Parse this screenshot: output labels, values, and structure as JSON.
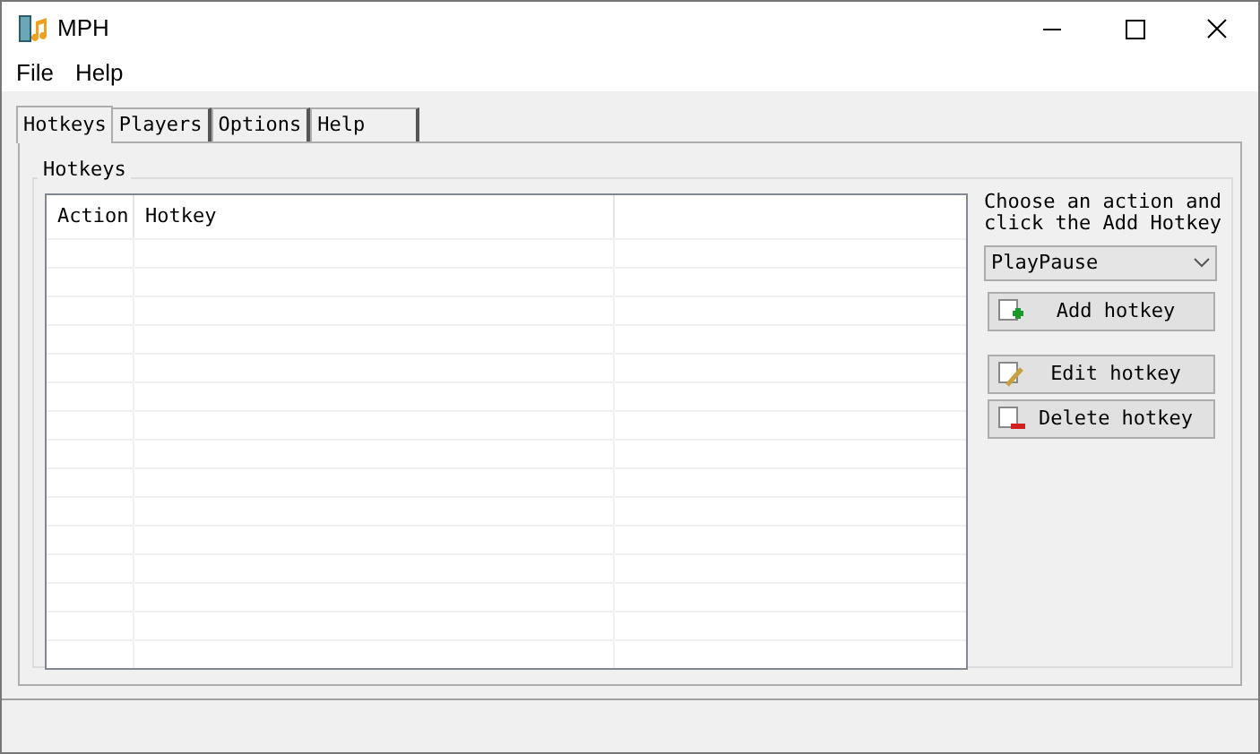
{
  "window": {
    "title": "MPH"
  },
  "menu": [
    "File",
    "Help"
  ],
  "tabs": [
    {
      "label": "Hotkeys",
      "selected": true
    },
    {
      "label": "Players",
      "selected": false
    },
    {
      "label": "Options",
      "selected": false
    },
    {
      "label": "Help",
      "selected": false
    }
  ],
  "group": {
    "title": "Hotkeys"
  },
  "table": {
    "columns": [
      "Action",
      "Hotkey"
    ]
  },
  "instructions": [
    "Choose an action and",
    "click the Add Hotkey"
  ],
  "action_dropdown": {
    "value": "PlayPause"
  },
  "buttons": [
    {
      "label": "Add hotkey",
      "kind": "add"
    },
    {
      "label": "Edit hotkey",
      "kind": "edit"
    },
    {
      "label": "Delete hotkey",
      "kind": "delete"
    }
  ]
}
